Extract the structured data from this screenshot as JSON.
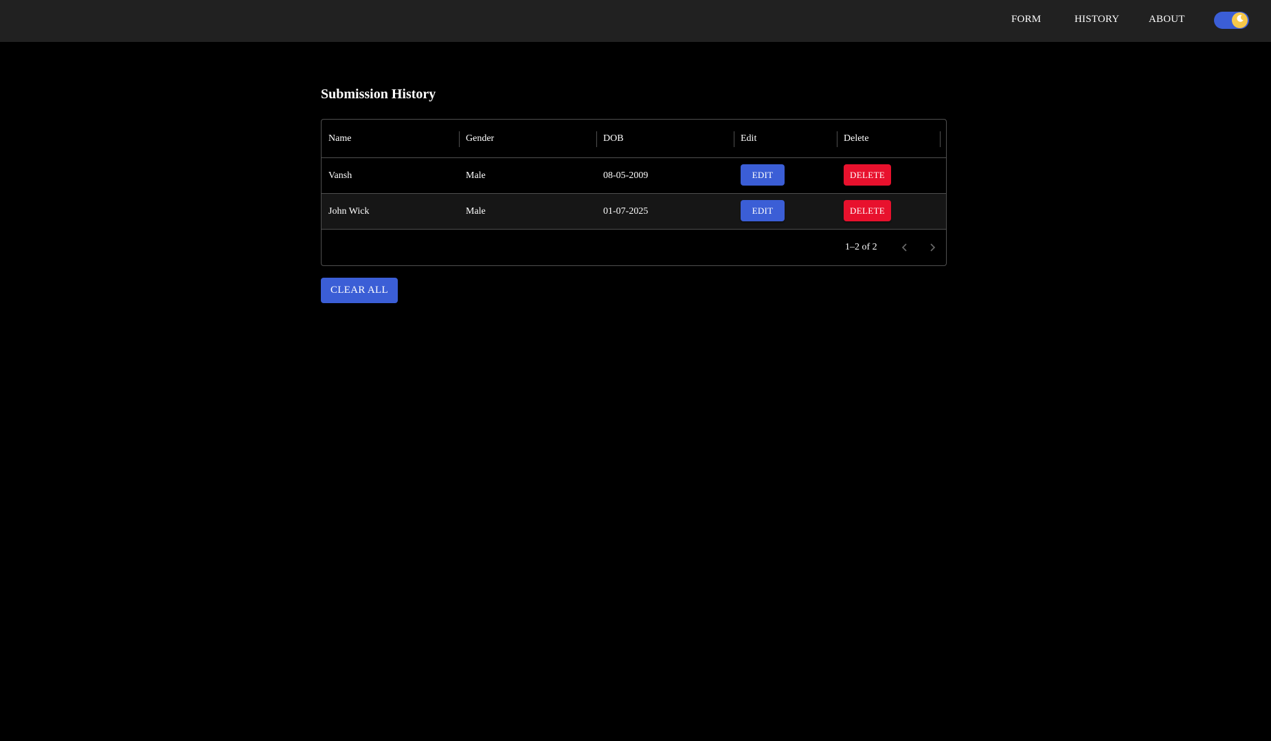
{
  "nav": {
    "links": [
      "FORM",
      "HISTORY",
      "ABOUT"
    ]
  },
  "theme_toggle": {
    "state": "dark",
    "icon": "moon-icon",
    "track_color": "#3b5ed6",
    "knob_color": "#f6c84a"
  },
  "page": {
    "title": "Submission History"
  },
  "table": {
    "columns": [
      "Name",
      "Gender",
      "DOB",
      "Edit",
      "Delete"
    ],
    "rows": [
      {
        "name": "Vansh",
        "gender": "Male",
        "dob": "08-05-2009",
        "edit_label": "EDIT",
        "delete_label": "DELETE"
      },
      {
        "name": "John Wick",
        "gender": "Male",
        "dob": "01-07-2025",
        "edit_label": "EDIT",
        "delete_label": "DELETE"
      }
    ],
    "pagination": {
      "text": "1–2 of 2",
      "prev_icon": "chevron-left-icon",
      "next_icon": "chevron-right-icon"
    }
  },
  "actions": {
    "clear_all_label": "CLEAR ALL"
  },
  "colors": {
    "background": "#000000",
    "navbar": "#212121",
    "primary": "#3b5ed6",
    "danger": "#e8112d",
    "border": "#505050"
  }
}
